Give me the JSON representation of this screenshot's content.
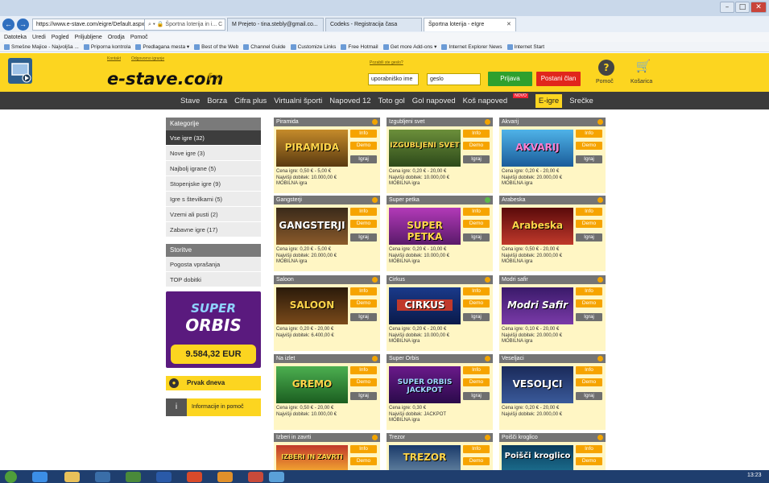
{
  "window": {
    "min_label": "–",
    "max_label": "□",
    "close_label": "✕"
  },
  "browser": {
    "back_label": "←",
    "forward_label": "→",
    "url": "https://www.e-stave.com/eigre/Default.aspx",
    "search_glyph": "⌕ ▾ 🔒 Športna loterija in i... C",
    "tabs": [
      {
        "label": "M Prejeto - tina.stebly@gmail.co..."
      },
      {
        "label": "Codeks - Registracija časa"
      },
      {
        "label": "Športna loterija - eIgre"
      }
    ],
    "tab_close": "✕",
    "menu": [
      "Datoteka",
      "Uredi",
      "Pogled",
      "Priljubljene",
      "Orodja",
      "Pomoč"
    ],
    "favorites": [
      "Smešne Majice - Najvoljša ...",
      "Priporna kontrola",
      "Predlagana mesta ▾",
      "Best of the Web",
      "Channel Guide",
      "Customize Links",
      "Free Hotmail",
      "Get more Add-ons ▾",
      "Internet Explorer News",
      "Internet Start"
    ]
  },
  "header": {
    "logo": "e-stave.com",
    "social": "f 𝕪",
    "top_links": [
      "Kontakt",
      "Odgovorno igranje"
    ],
    "forgot_link": "Pozabili ste geslo?",
    "username_placeholder": "uporabniško ime",
    "password_placeholder": "geslo",
    "login_label": "Prijava",
    "register_label": "Postani član",
    "help_icon": "?",
    "help_label": "Pomoč",
    "cart_icon": "🛒",
    "cart_label": "Košarica"
  },
  "nav": {
    "items": [
      "Stave",
      "Borza",
      "Cifra plus",
      "Virtualni športi",
      "Napoved 12",
      "Toto gol",
      "Gol napoved",
      "Koš napoved",
      "E-igre",
      "Srečke"
    ],
    "badge": "NOVO"
  },
  "sidebar": {
    "categories_title": "Kategorije",
    "categories": [
      "Vse igre (32)",
      "Nove igre (3)",
      "Najbolj igrane (5)",
      "Stopenjske igre (9)",
      "Igre s številkami (5)",
      "Vzemi ali pusti (2)",
      "Zabavne igre (17)"
    ],
    "services_title": "Storitve",
    "services": [
      "Pogosta vprašanja",
      "TOP dobitki"
    ],
    "promo_line1": "SUPER",
    "promo_line2": "ORBIS",
    "jackpot": "9.584,32 EUR",
    "champ_label": "Prvak dneva",
    "info_label": "Informacije in pomoč"
  },
  "card_buttons": {
    "info": "Info",
    "demo": "Demo",
    "play": "Igraj"
  },
  "games": [
    {
      "name": "Piramida",
      "img": "PIRAMIDA",
      "price": "Cena igre: 0,50 € - 5,00 €",
      "prize": "Najvišji dobitek: 10.000,00 €",
      "mobile": "MOBILNA igra"
    },
    {
      "name": "Izgubljeni svet",
      "img": "IZGUBLJENI SVET",
      "price": "Cena igre: 0,20 € - 20,00 €",
      "prize": "Najvišji dobitek: 10.000,00 €",
      "mobile": "MOBILNA igra"
    },
    {
      "name": "Akvarij",
      "img": "AKVARIJ",
      "price": "Cena igre: 0,20 € - 20,00 €",
      "prize": "Najvišji dobitek: 20.000,00 €",
      "mobile": "MOBILNA igra"
    },
    {
      "name": "Gangsterji",
      "img": "GANGSTERJI",
      "price": "Cena igre: 0,20 € - 5,00 €",
      "prize": "Najvišji dobitek: 20.000,00 €",
      "mobile": "MOBILNA igra"
    },
    {
      "name": "Super petka",
      "img": "SUPER PETKA",
      "price": "Cena igre: 0,20 € - 10,00 €",
      "prize": "Najvišji dobitek: 10.000,00 €",
      "mobile": "MOBILNA igra"
    },
    {
      "name": "Arabeska",
      "img": "Arabeska",
      "price": "Cena igre: 0,50 € - 20,00 €",
      "prize": "Najvišji dobitek: 20.000,00 €",
      "mobile": "MOBILNA igra"
    },
    {
      "name": "Saloon",
      "img": "SALOON",
      "price": "Cena igre: 0,20 € - 20,00 €",
      "prize": "Najvišji dobitek: 6.400,00 €",
      "mobile": ""
    },
    {
      "name": "Cirkus",
      "img": "CIRKUS",
      "price": "Cena igre: 0,20 € - 20,00 €",
      "prize": "Najvišji dobitek: 10.000,00 €",
      "mobile": "MOBILNA igra"
    },
    {
      "name": "Modri safir",
      "img": "Modri Safir",
      "price": "Cena igre: 0,10 € - 20,00 €",
      "prize": "Najvišji dobitek: 20.000,00 €",
      "mobile": "MOBILNA igra"
    },
    {
      "name": "Na izlet",
      "img": "GREMO",
      "price": "Cena igre: 0,50 € - 20,00 €",
      "prize": "Najvišji dobitek: 10.000,00 €",
      "mobile": ""
    },
    {
      "name": "Super Orbis",
      "img": "SUPER ORBIS JACKPOT",
      "price": "Cena igre: 0,30 €",
      "prize": "Najvišji dobitek: JACKPOT",
      "mobile": "MOBILNA igra"
    },
    {
      "name": "Veseljaci",
      "img": "VESOLJCI",
      "price": "Cena igre: 0,20 € - 20,00 €",
      "prize": "Najvišji dobitek: 20.000,00 €",
      "mobile": ""
    },
    {
      "name": "Izberi in zavrti",
      "img": "IZBERI IN ZAVRTI",
      "price": "",
      "prize": "",
      "mobile": ""
    },
    {
      "name": "Trezor",
      "img": "TREZOR",
      "price": "",
      "prize": "",
      "mobile": ""
    },
    {
      "name": "Poišči kroglico",
      "img": "Poišči kroglico",
      "price": "",
      "prize": "",
      "mobile": ""
    }
  ],
  "taskbar": {
    "time": "13:23"
  },
  "colors": {
    "brand_yellow": "#fcd520",
    "nav_dark": "#3b3b3b",
    "login_green": "#2ea02e",
    "register_red": "#e1261c",
    "card_orange": "#f6a400"
  }
}
